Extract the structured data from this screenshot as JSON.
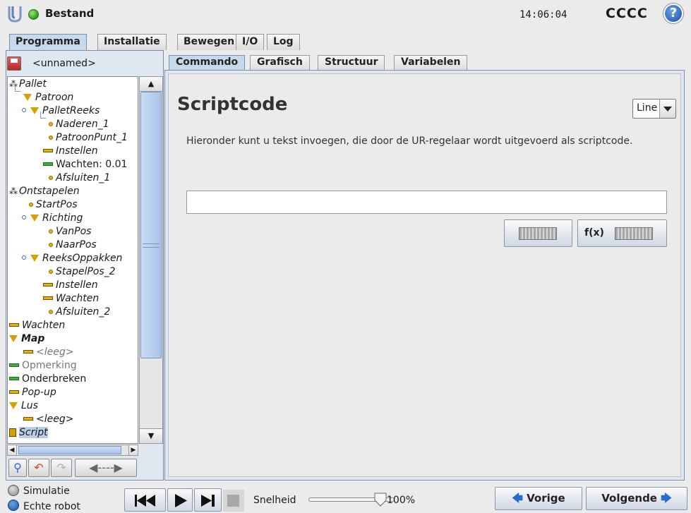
{
  "header": {
    "title": "Bestand",
    "clock": "14:06:04",
    "robot_name": "CCCC",
    "help_glyph": "?"
  },
  "main_tabs": [
    {
      "label": "Programma",
      "active": true
    },
    {
      "label": "Installatie",
      "active": false
    },
    {
      "label": "Bewegen",
      "active": false
    },
    {
      "label": "I/O",
      "active": false
    },
    {
      "label": "Log",
      "active": false
    }
  ],
  "program": {
    "name": "<unnamed>"
  },
  "tree": [
    {
      "label": "Pallet",
      "icon": "pallet-icon"
    },
    {
      "label": "Patroon",
      "icon": "folder-triangle-icon"
    },
    {
      "label": "PalletReeks",
      "icon": "folder-triangle-icon"
    },
    {
      "label": "Naderen_1",
      "icon": "waypoint-icon"
    },
    {
      "label": "PatroonPunt_1",
      "icon": "waypoint-icon"
    },
    {
      "label": "Instellen",
      "icon": "set-icon"
    },
    {
      "label": "Wachten: 0.01",
      "icon": "wait-icon"
    },
    {
      "label": "Afsluiten_1",
      "icon": "waypoint-icon"
    },
    {
      "label": "Ontstapelen",
      "icon": "pallet-icon"
    },
    {
      "label": "StartPos",
      "icon": "waypoint-icon"
    },
    {
      "label": "Richting",
      "icon": "folder-triangle-icon"
    },
    {
      "label": "VanPos",
      "icon": "waypoint-icon"
    },
    {
      "label": "NaarPos",
      "icon": "waypoint-icon"
    },
    {
      "label": "ReeksOppakken",
      "icon": "folder-triangle-icon"
    },
    {
      "label": "StapelPos_2",
      "icon": "waypoint-icon"
    },
    {
      "label": "Instellen",
      "icon": "set-icon"
    },
    {
      "label": "Wachten",
      "icon": "set-icon"
    },
    {
      "label": "Afsluiten_2",
      "icon": "waypoint-icon"
    },
    {
      "label": "Wachten",
      "icon": "set-icon"
    },
    {
      "label": "Map",
      "icon": "folder-triangle-icon"
    },
    {
      "label": "<leeg>",
      "icon": "set-icon"
    },
    {
      "label": "Opmerking",
      "icon": "comment-icon"
    },
    {
      "label": "Onderbreken",
      "icon": "halt-icon"
    },
    {
      "label": "Pop-up",
      "icon": "set-icon"
    },
    {
      "label": "Lus",
      "icon": "folder-triangle-icon"
    },
    {
      "label": "<leeg>",
      "icon": "set-icon"
    },
    {
      "label": "Script",
      "icon": "script-icon"
    }
  ],
  "sub_tabs": [
    {
      "label": "Commando",
      "active": true
    },
    {
      "label": "Grafisch",
      "active": false
    },
    {
      "label": "Structuur",
      "active": false
    },
    {
      "label": "Variabelen",
      "active": false
    }
  ],
  "script_panel": {
    "title": "Scriptcode",
    "mode": "Line",
    "description": "Hieronder kunt u tekst invoegen, die door de UR-regelaar wordt uitgevoerd als scriptcode.",
    "input_value": "",
    "fx_label": "f(x)"
  },
  "footer": {
    "simulation_label": "Simulatie",
    "real_robot_label": "Echte robot",
    "speed_label": "Snelheid",
    "speed_value": "100%",
    "speed_fraction": 1.0,
    "prev_label": "Vorige",
    "next_label": "Volgende"
  },
  "colors": {
    "accent": "#2a6ad0",
    "active_tab": "#c9d9ec",
    "status_green": "#2e9a1a"
  }
}
